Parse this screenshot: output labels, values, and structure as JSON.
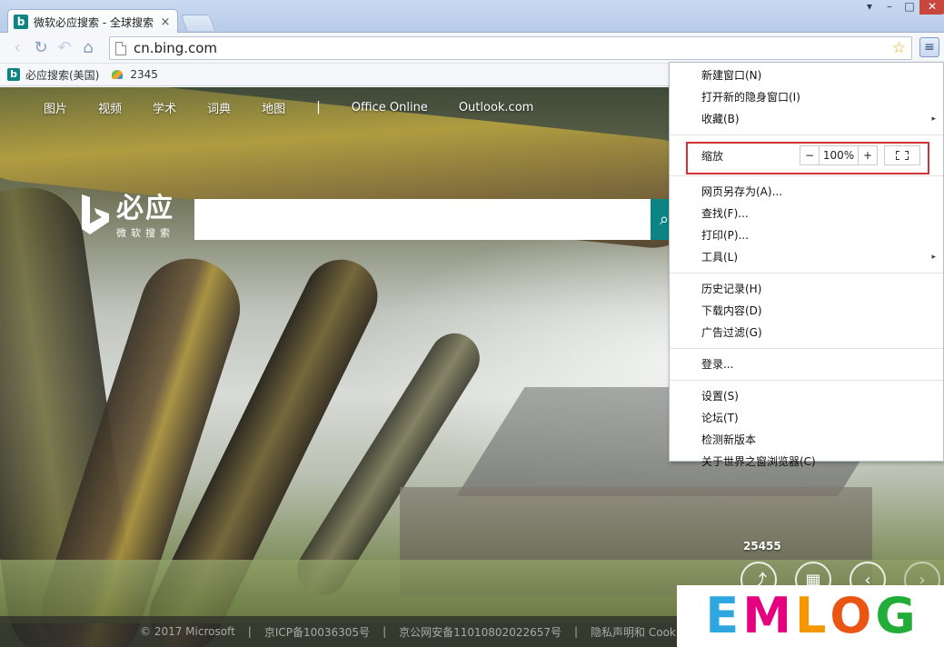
{
  "window": {
    "tab_title": "微软必应搜索 - 全球搜索",
    "tab_favicon_glyph": "b",
    "tab_close": "×",
    "controls": {
      "minimize": "▾",
      "maximize": "–",
      "restore": "□",
      "close": "✕"
    }
  },
  "toolbar": {
    "back": "‹",
    "reload": "↻",
    "undo": "↶",
    "home": "⌂",
    "url": "cn.bing.com",
    "star": "☆",
    "menu": "≡"
  },
  "bookmarks": [
    {
      "label": "必应搜索(美国)",
      "icon": "bing-icon"
    },
    {
      "label": "2345",
      "icon": "2345-icon"
    }
  ],
  "page": {
    "nav": [
      "图片",
      "视频",
      "学术",
      "词典",
      "地图"
    ],
    "nav_sep": "|",
    "nav_links": [
      "Office Online",
      "Outlook.com"
    ],
    "logo_main": "必应",
    "logo_sub": "微软搜索",
    "search_icon": "⌕",
    "counter": "25455",
    "circle_icons": [
      "⤴",
      "▦",
      "‹",
      "›"
    ],
    "footer": [
      "© 2017 Microsoft",
      "|",
      "京ICP备10036305号",
      "|",
      "京公网安备11010802022657号",
      "|",
      "隐私声明和 Cookie"
    ]
  },
  "watermark": {
    "letters": [
      "E",
      "M",
      "L",
      "O",
      "G"
    ],
    "colors": [
      "#2ea7e0",
      "#e4007f",
      "#f39800",
      "#ea5514",
      "#22ac38"
    ]
  },
  "menu": {
    "group1": [
      {
        "label": "新建窗口(N)",
        "submenu": false
      },
      {
        "label": "打开新的隐身窗口(I)",
        "submenu": false
      },
      {
        "label": "收藏(B)",
        "submenu": true
      }
    ],
    "zoom": {
      "label": "缩放",
      "minus": "−",
      "value": "100%",
      "plus": "+"
    },
    "group2": [
      {
        "label": "网页另存为(A)...",
        "submenu": false
      },
      {
        "label": "查找(F)...",
        "submenu": false
      },
      {
        "label": "打印(P)...",
        "submenu": false
      },
      {
        "label": "工具(L)",
        "submenu": true
      }
    ],
    "group3": [
      {
        "label": "历史记录(H)"
      },
      {
        "label": "下载内容(D)"
      },
      {
        "label": "广告过滤(G)"
      }
    ],
    "group4": [
      {
        "label": "登录..."
      }
    ],
    "group5": [
      {
        "label": "设置(S)"
      },
      {
        "label": "论坛(T)"
      },
      {
        "label": "检测新版本"
      },
      {
        "label": "关于世界之窗浏览器(C)"
      }
    ],
    "arrow": "▸"
  },
  "colors": {
    "accent": "#0c8484",
    "highlight": "#d43232"
  }
}
